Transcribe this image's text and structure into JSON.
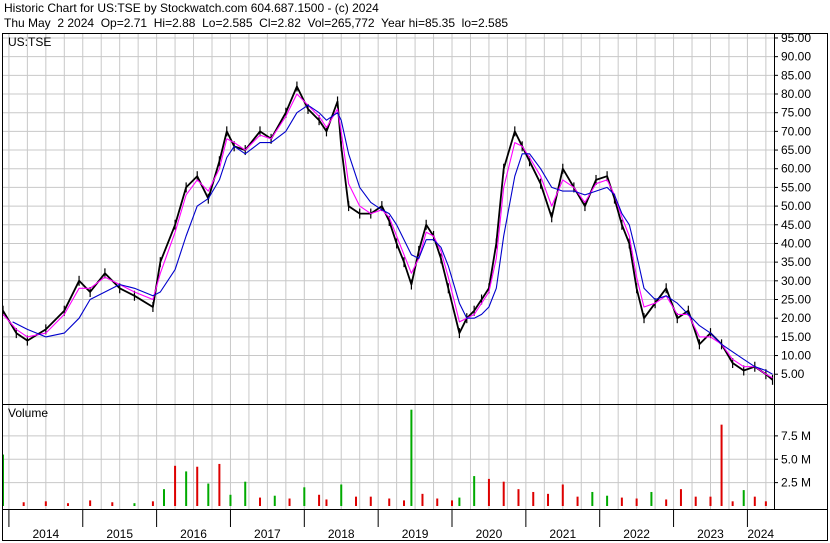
{
  "header": {
    "line1": "Historic Chart for US:TSE by Stockwatch.com 604.687.1500 - (c) 2024",
    "line2": "Thu May  2 2024  Op=2.71  Hi=2.88  Lo=2.585  Cl=2.82  Vol=265,772  Year hi=85.35  lo=2.585"
  },
  "colors": {
    "price_bars": "#000000",
    "short_ma": "#ff00ff",
    "long_ma": "#0000cc",
    "volume_up": "#00aa00",
    "volume_down": "#dd0000",
    "grid": "#c8c8c8"
  },
  "chart_data": [
    {
      "type": "line",
      "panel": "price",
      "symbol_label": "US:TSE",
      "grid": true,
      "ylim": [
        2.585,
        97
      ],
      "y_ticks": [
        "95.00",
        "90.00",
        "85.00",
        "80.00",
        "75.00",
        "70.00",
        "65.00",
        "60.00",
        "55.00",
        "50.00",
        "45.00",
        "40.00",
        "35.00",
        "30.00",
        "25.00",
        "20.00",
        "15.00",
        "10.00",
        "5.00"
      ],
      "x_ticks": [
        "2014",
        "2015",
        "2016",
        "2017",
        "2018",
        "2019",
        "2020",
        "2021",
        "2022",
        "2023",
        "2024"
      ],
      "series": [
        {
          "role": "price",
          "x": [
            2013.92,
            2014.1,
            2014.25,
            2014.5,
            2014.75,
            2014.95,
            2015.1,
            2015.3,
            2015.5,
            2015.7,
            2015.95,
            2016.05,
            2016.25,
            2016.4,
            2016.55,
            2016.7,
            2016.85,
            2016.95,
            2017.05,
            2017.2,
            2017.4,
            2017.55,
            2017.75,
            2017.9,
            2018.05,
            2018.2,
            2018.3,
            2018.45,
            2018.5,
            2018.6,
            2018.75,
            2018.9,
            2019.05,
            2019.15,
            2019.25,
            2019.35,
            2019.45,
            2019.55,
            2019.65,
            2019.75,
            2019.85,
            2019.95,
            2020.1,
            2020.2,
            2020.3,
            2020.4,
            2020.5,
            2020.6,
            2020.7,
            2020.85,
            2020.95,
            2021.05,
            2021.2,
            2021.35,
            2021.5,
            2021.65,
            2021.8,
            2021.95,
            2022.1,
            2022.2,
            2022.3,
            2022.4,
            2022.5,
            2022.6,
            2022.75,
            2022.9,
            2023.05,
            2023.2,
            2023.35,
            2023.5,
            2023.65,
            2023.8,
            2023.95,
            2024.1,
            2024.25,
            2024.34
          ],
          "values": [
            22,
            16,
            14,
            17,
            22,
            30,
            27,
            32,
            28,
            26,
            23,
            35,
            45,
            55,
            58,
            52,
            62,
            70,
            66,
            65,
            70,
            68,
            75,
            82,
            76,
            73,
            70,
            78,
            66,
            50,
            48,
            48,
            50,
            46,
            40,
            35,
            29,
            38,
            45,
            42,
            36,
            28,
            16,
            20,
            22,
            25,
            28,
            40,
            60,
            70,
            66,
            62,
            56,
            47,
            60,
            55,
            50,
            57,
            58,
            52,
            45,
            40,
            28,
            20,
            24,
            28,
            20,
            22,
            13,
            16,
            13,
            8,
            6,
            7,
            5,
            3.5
          ]
        },
        {
          "role": "short moving average",
          "x": [
            2013.92,
            2014.1,
            2014.25,
            2014.5,
            2014.75,
            2014.95,
            2015.1,
            2015.3,
            2015.5,
            2015.7,
            2015.95,
            2016.05,
            2016.25,
            2016.4,
            2016.55,
            2016.7,
            2016.85,
            2016.95,
            2017.05,
            2017.2,
            2017.4,
            2017.55,
            2017.75,
            2017.9,
            2018.05,
            2018.2,
            2018.3,
            2018.45,
            2018.5,
            2018.6,
            2018.75,
            2018.9,
            2019.05,
            2019.15,
            2019.25,
            2019.35,
            2019.45,
            2019.55,
            2019.65,
            2019.75,
            2019.85,
            2019.95,
            2020.1,
            2020.2,
            2020.3,
            2020.4,
            2020.5,
            2020.6,
            2020.7,
            2020.85,
            2020.95,
            2021.05,
            2021.2,
            2021.35,
            2021.5,
            2021.65,
            2021.8,
            2021.95,
            2022.1,
            2022.2,
            2022.3,
            2022.4,
            2022.5,
            2022.6,
            2022.75,
            2022.9,
            2023.05,
            2023.2,
            2023.35,
            2023.5,
            2023.65,
            2023.8,
            2023.95,
            2024.1,
            2024.25,
            2024.34
          ],
          "values": [
            21,
            17,
            15,
            16,
            21,
            28,
            28,
            31,
            29,
            27,
            25,
            32,
            43,
            53,
            57,
            54,
            60,
            68,
            67,
            65,
            69,
            68,
            74,
            80,
            77,
            74,
            71,
            76,
            70,
            56,
            50,
            48,
            49,
            47,
            42,
            37,
            32,
            36,
            43,
            42,
            38,
            31,
            19,
            20,
            21,
            24,
            27,
            36,
            55,
            67,
            66,
            63,
            58,
            50,
            57,
            55,
            51,
            56,
            57,
            53,
            47,
            42,
            31,
            23,
            24,
            26,
            21,
            21,
            15,
            15,
            13,
            9,
            7,
            7,
            5,
            4
          ]
        },
        {
          "role": "long moving average",
          "x": [
            2014.05,
            2014.25,
            2014.5,
            2014.75,
            2014.95,
            2015.1,
            2015.3,
            2015.5,
            2015.7,
            2015.95,
            2016.05,
            2016.25,
            2016.4,
            2016.55,
            2016.7,
            2016.85,
            2016.95,
            2017.05,
            2017.2,
            2017.4,
            2017.55,
            2017.75,
            2017.9,
            2018.05,
            2018.2,
            2018.3,
            2018.45,
            2018.5,
            2018.6,
            2018.75,
            2018.9,
            2019.05,
            2019.15,
            2019.25,
            2019.35,
            2019.45,
            2019.55,
            2019.65,
            2019.75,
            2019.85,
            2019.95,
            2020.1,
            2020.2,
            2020.3,
            2020.4,
            2020.5,
            2020.6,
            2020.7,
            2020.85,
            2020.95,
            2021.05,
            2021.2,
            2021.35,
            2021.5,
            2021.65,
            2021.8,
            2021.95,
            2022.1,
            2022.2,
            2022.3,
            2022.4,
            2022.5,
            2022.6,
            2022.75,
            2022.9,
            2023.05,
            2023.2,
            2023.35,
            2023.5,
            2023.65,
            2023.8,
            2023.95,
            2024.1,
            2024.25,
            2024.34
          ],
          "values": [
            19,
            17,
            15,
            16,
            20,
            25,
            27,
            29,
            28,
            26,
            27,
            33,
            42,
            50,
            52,
            57,
            63,
            66,
            64,
            67,
            67,
            70,
            75,
            77,
            75,
            73,
            75,
            73,
            64,
            55,
            51,
            49,
            48,
            45,
            41,
            37,
            36,
            41,
            41,
            39,
            34,
            24,
            20,
            20,
            21,
            23,
            28,
            42,
            58,
            64,
            64,
            60,
            55,
            54,
            54,
            53,
            54,
            55,
            53,
            48,
            45,
            37,
            28,
            25,
            26,
            24,
            21,
            18,
            16,
            13,
            11,
            9,
            7,
            6,
            5
          ]
        }
      ]
    },
    {
      "type": "bar",
      "panel": "volume",
      "ylabel": "Volume",
      "y_ticks": [
        "7.5 M",
        "5.0 M",
        "2.5 M"
      ],
      "ylim": [
        0,
        10.3
      ],
      "unit": "M",
      "x": [
        2013.92,
        2014.2,
        2014.5,
        2014.8,
        2015.1,
        2015.4,
        2015.7,
        2015.95,
        2016.1,
        2016.25,
        2016.4,
        2016.55,
        2016.7,
        2016.85,
        2017.0,
        2017.2,
        2017.4,
        2017.6,
        2017.8,
        2018.0,
        2018.2,
        2018.3,
        2018.5,
        2018.7,
        2018.9,
        2019.15,
        2019.35,
        2019.45,
        2019.6,
        2019.8,
        2020.0,
        2020.1,
        2020.3,
        2020.5,
        2020.7,
        2020.9,
        2021.1,
        2021.3,
        2021.5,
        2021.7,
        2021.9,
        2022.1,
        2022.3,
        2022.5,
        2022.7,
        2022.9,
        2023.1,
        2023.3,
        2023.5,
        2023.65,
        2023.8,
        2023.95,
        2024.1,
        2024.25
      ],
      "values": [
        5.5,
        0.4,
        0.5,
        0.3,
        0.6,
        0.4,
        0.3,
        0.5,
        1.8,
        4.3,
        3.7,
        4.2,
        2.4,
        4.5,
        1.2,
        2.6,
        0.9,
        1.1,
        0.8,
        2.0,
        1.2,
        0.7,
        2.3,
        1.0,
        1.0,
        0.8,
        0.6,
        10.3,
        1.3,
        0.8,
        0.6,
        0.9,
        3.2,
        2.9,
        2.6,
        1.8,
        1.5,
        1.3,
        2.3,
        1.0,
        1.5,
        1.1,
        0.9,
        0.8,
        1.5,
        0.7,
        1.8,
        1.0,
        1.0,
        8.7,
        0.5,
        1.7,
        1.0,
        0.5
      ],
      "direction": [
        "up",
        "down",
        "down",
        "down",
        "down",
        "down",
        "up",
        "down",
        "up",
        "down",
        "up",
        "down",
        "up",
        "down",
        "up",
        "up",
        "down",
        "up",
        "down",
        "up",
        "down",
        "down",
        "up",
        "down",
        "down",
        "down",
        "down",
        "up",
        "down",
        "down",
        "down",
        "up",
        "up",
        "down",
        "down",
        "down",
        "down",
        "down",
        "down",
        "down",
        "up",
        "up",
        "down",
        "down",
        "up",
        "down",
        "down",
        "down",
        "down",
        "down",
        "down",
        "up",
        "down",
        "down"
      ]
    }
  ]
}
